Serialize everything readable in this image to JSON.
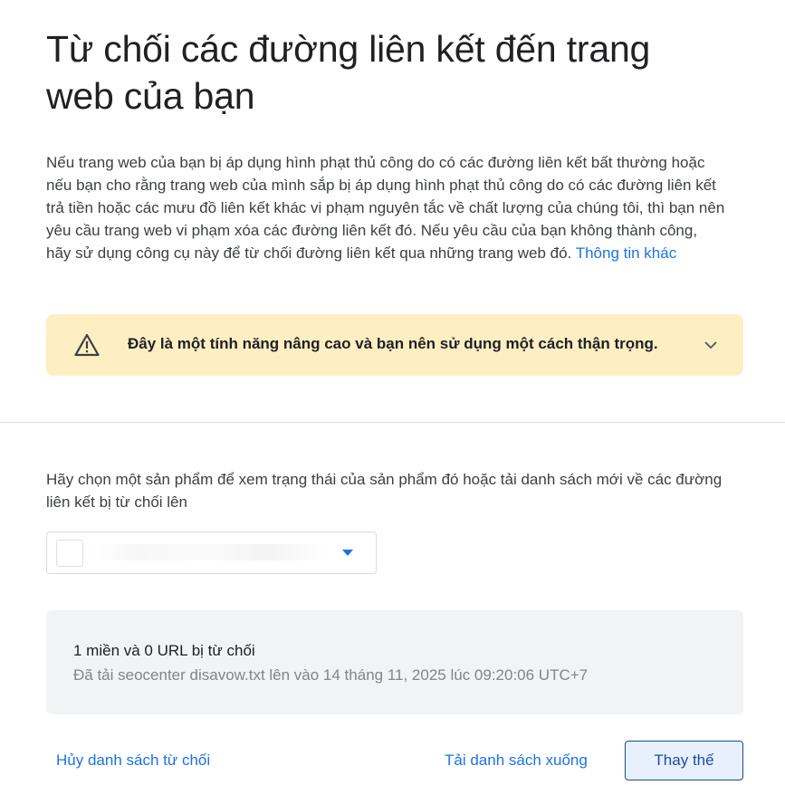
{
  "page": {
    "title": "Từ chối các đường liên kết đến trang web của bạn",
    "intro_text": "Nếu trang web của bạn bị áp dụng hình phạt thủ công do có các đường liên kết bất thường hoặc nếu bạn cho rằng trang web của mình sắp bị áp dụng hình phạt thủ công do có các đường liên kết trả tiền hoặc các mưu đồ liên kết khác vi phạm nguyên tắc về chất lượng của chúng tôi, thì bạn nên yêu cầu trang web vi phạm xóa các đường liên kết đó. Nếu yêu cầu của bạn không thành công, hãy sử dụng công cụ này để từ chối đường liên kết qua những trang web đó.",
    "more_info_link": "Thông tin khác"
  },
  "warning": {
    "icon": "warning-triangle-icon",
    "text": "Đây là một tính năng nâng cao và bạn nên sử dụng một cách thận trọng.",
    "expand_icon": "chevron-down-icon"
  },
  "selection": {
    "prompt": "Hãy chọn một sản phẩm để xem trạng thái của sản phẩm đó hoặc tải danh sách mới về các đường liên kết bị từ chối lên",
    "selected_value": "",
    "dropdown_icon": "dropdown-arrow-icon"
  },
  "status": {
    "summary": "1 miền và 0 URL bị từ chối",
    "detail": "Đã tải seocenter disavow.txt lên vào 14 tháng 11, 2025 lúc 09:20:06 UTC+7"
  },
  "actions": {
    "cancel_label": "Hủy danh sách từ chối",
    "download_label": "Tải danh sách xuống",
    "replace_label": "Thay thế"
  },
  "colors": {
    "accent": "#1a73e8",
    "warning_bg": "#feefc3",
    "status_bg": "#f1f3f4",
    "replace_bg": "#e8f0fe"
  }
}
